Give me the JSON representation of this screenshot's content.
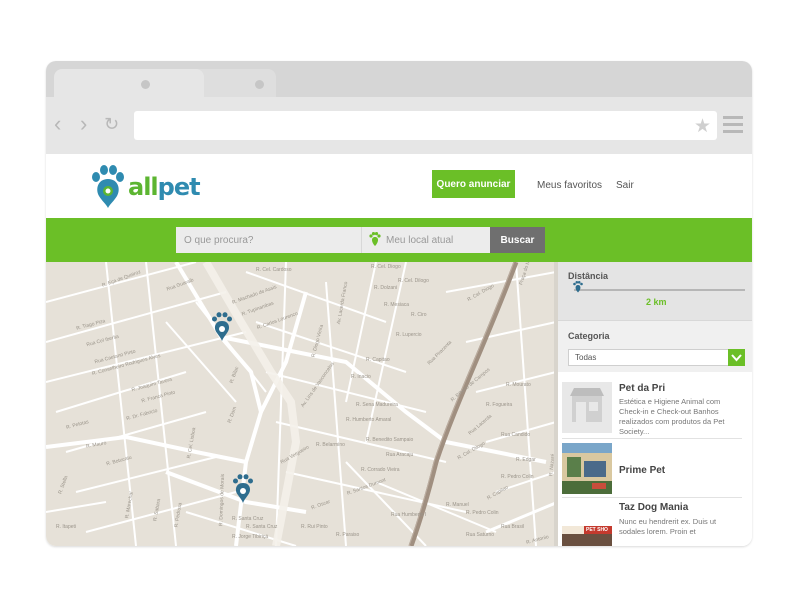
{
  "header": {
    "logo_text_a": "all",
    "logo_text_b": "pet",
    "cta_label": "Quero anunciar",
    "nav": [
      "Meus favoritos",
      "Sair"
    ]
  },
  "search": {
    "placeholder": "O que procura?",
    "location_placeholder": "Meu local atual",
    "button_label": "Buscar"
  },
  "map": {
    "streets": [
      "R. Cel. Diogo",
      "R. Cel. Dilogo",
      "R. Dolzani",
      "R. Mesiaca",
      "R. Ciro",
      "Praça do Monumento",
      "R. Cel. Diogo",
      "R. Lupercio",
      "Rua Piracenta",
      "R. Capitao",
      "R. Inacio",
      "R. Ribeiro de Campos",
      "R. Mourato",
      "R. Fogueira",
      "Rua Lacerda",
      "Rua Candido",
      "R. Cel. Dilogo",
      "R. Edgar",
      "R. Pedro Colin",
      "R. Capitao",
      "R. Pedro Colin",
      "Rua Brasil",
      "R. Eça de Queiroz",
      "Rua Guaraib",
      "R. Machado de Assis",
      "R. Tupinambas",
      "R. Carlos Lourenco",
      "R. Tiago Piza",
      "Rua Cel Iberita",
      "Rua Caetano Pinto",
      "R. Conselheiro Rodrigues Alves",
      "R. Joaquim Tavora",
      "R. Franca Pinto",
      "R. Pelotas",
      "R. Dr. Fabricio",
      "R. Cel. Lisboa",
      "Av. Lins de Vasconcelos",
      "R. Diogo Vieira",
      "R. Sena Madureira",
      "R. Humberto Amaral",
      "Av. Lacerda Franco",
      "R. Benedito Sampaio",
      "Rua Aracaju",
      "R. Corrado Vieira",
      "R. Santos Dumont",
      "R. Bilac",
      "R. Dom",
      "R. Belarmino",
      "R. Oscar",
      "R. Santa Cruz",
      "R. Jorge Tibiriçá",
      "R. Domingos de Morais",
      "Rua Vergueiro",
      "Rua Humberto I",
      "R. Botucatu",
      "R. Mauro",
      "R. Stella",
      "R. Santa Cruz",
      "R. Rui Pinto",
      "R. Paraiso",
      "R. Marechal",
      "R. Sabara",
      "R. Pedrosa",
      "R. Itapeti",
      "R. Cel. Cardoso",
      "R. Manuel",
      "Rua Saturno",
      "R. Nazaré",
      "R. Antonio"
    ]
  },
  "filters": {
    "distance_label": "Distância",
    "distance_value": "2 km",
    "distance_fraction": 0.02,
    "category_label": "Categoria",
    "category_selected": "Todas"
  },
  "results": [
    {
      "title": "Pet da Pri",
      "desc": "Estética e Higiene Animal com Check-in e Check-out Banhos realizados com produtos da Pet Society...",
      "thumb": "store-icon"
    },
    {
      "title": "Prime Pet",
      "desc": "",
      "thumb": "photo"
    },
    {
      "title": "Taz Dog Mania",
      "desc": "Nunc eu hendrerit ex. Duis ut sodales lorem. Proin et",
      "thumb": "photo",
      "thumb_text": "PET SHO"
    }
  ],
  "colors": {
    "brand_green": "#6bbf27",
    "brand_blue": "#2f8bb0",
    "map_pin": "#2e6d8e"
  }
}
